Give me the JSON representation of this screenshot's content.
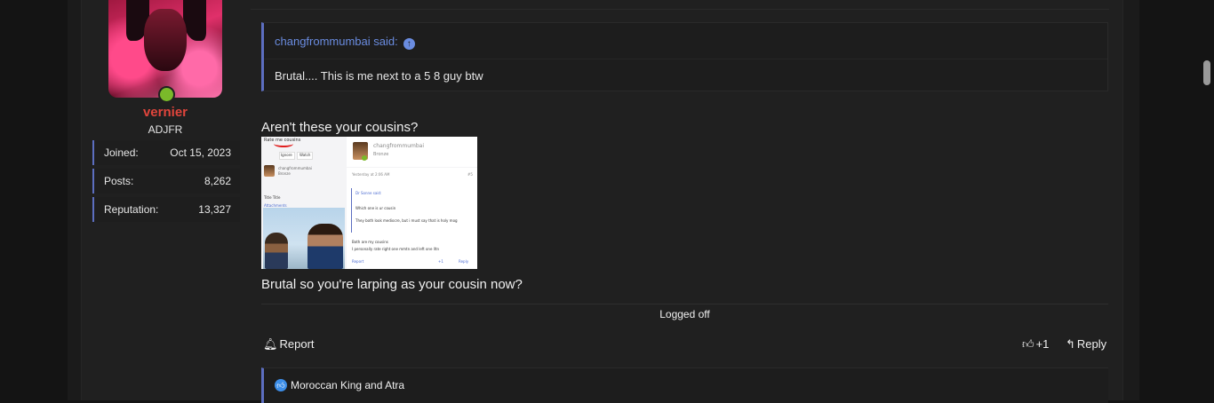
{
  "user": {
    "name": "vernier",
    "title": "ADJFR",
    "stats": [
      {
        "label": "Joined:",
        "value": "Oct 15, 2023"
      },
      {
        "label": "Posts:",
        "value": "8,262"
      },
      {
        "label": "Reputation:",
        "value": "13,327"
      }
    ]
  },
  "quote": {
    "author_said": "changfrommumbai said:",
    "body": "Brutal.... This is me next to a 5 8 guy btw"
  },
  "post": {
    "line1": "Aren't these your cousins?",
    "line2": "Brutal so you're larping as your cousin now?",
    "signature": "Logged off"
  },
  "embedded_screenshot": {
    "rate_title": "Rate me cousins",
    "ignore": "Ignore",
    "watch": "Watch",
    "user_small": "changfrommumbai",
    "rank_small": "Bronze",
    "title_label": "Title Title",
    "attachments": "Attachments",
    "user_large": "changfrommumbai",
    "rank_large": "Bronze",
    "timestamp": "Yesterday at 2:06 AM",
    "post_no": "#5",
    "quoted_said": "Dr Sonne said:",
    "q1": "Which one is ur cousin",
    "q2": "They both look mediocre, but i must say that is holy mog",
    "r1": "Both are my cousins",
    "r2": "I personally rate right one mmtn and left one lltn",
    "report": "Report",
    "like": "+1",
    "reply": "Reply"
  },
  "actions": {
    "report": "Report",
    "like_count": "+1",
    "reply": "Reply"
  },
  "reactions": {
    "text": "Moroccan King and Atra"
  }
}
